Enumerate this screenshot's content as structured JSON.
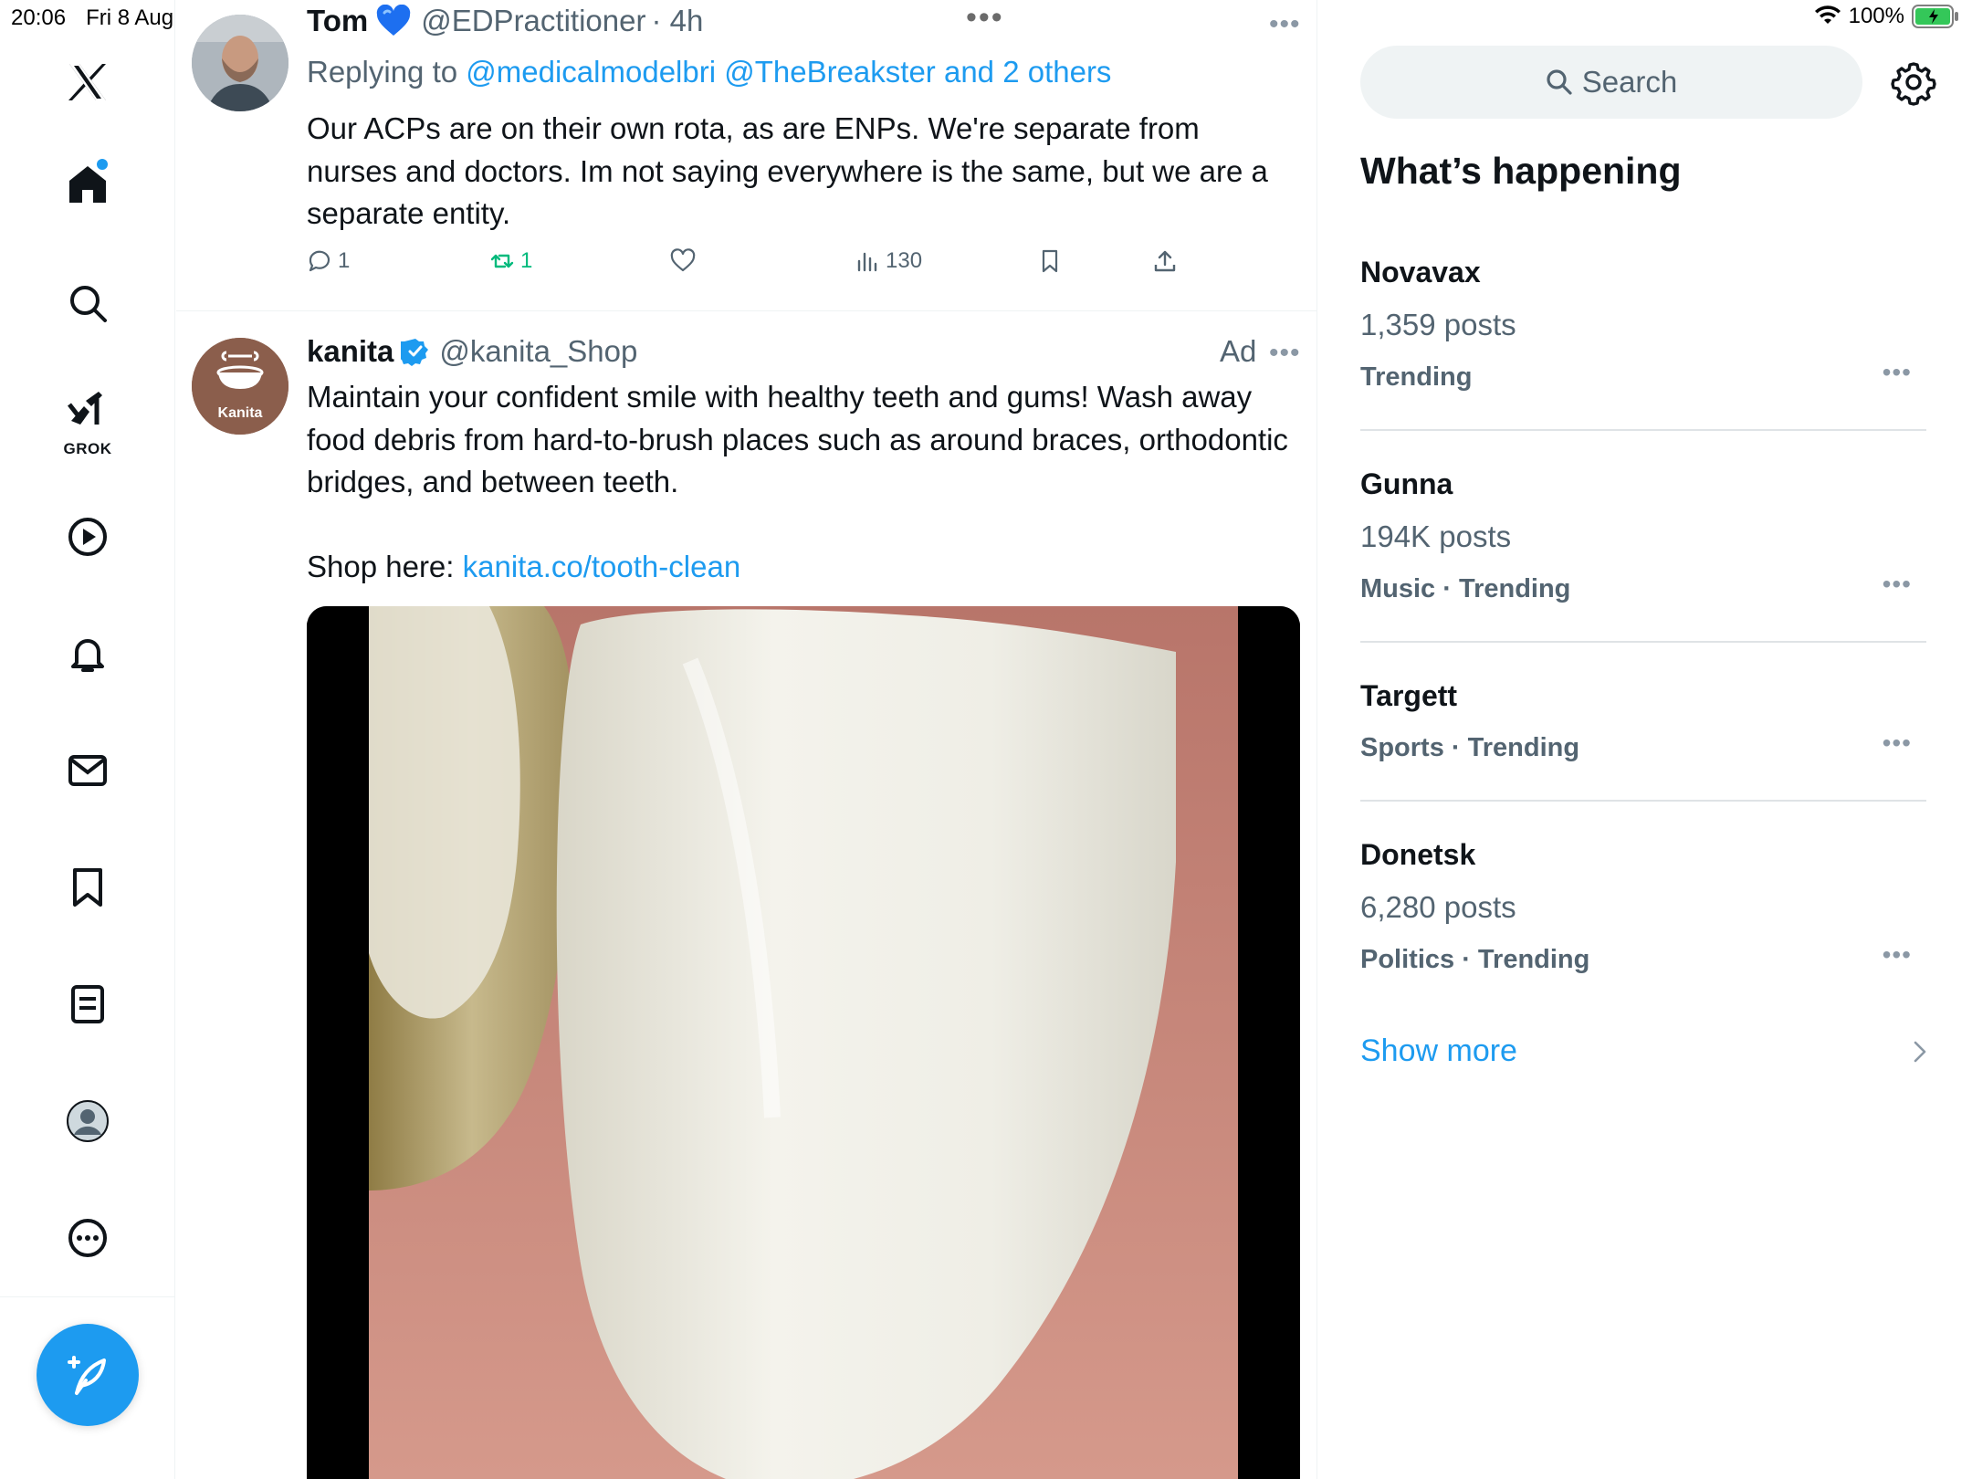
{
  "status_bar": {
    "time": "20:06",
    "date": "Fri 8 Aug",
    "battery": "100%"
  },
  "sidebar": {
    "logo": "x-logo-icon",
    "grok_label": "GROK",
    "items": [
      "home-icon",
      "search-icon",
      "grok-icon",
      "video-icon",
      "notifications-icon",
      "messages-icon",
      "bookmarks-icon",
      "lists-icon",
      "profile-icon",
      "more-icon"
    ],
    "compose": "compose-post-icon"
  },
  "timeline": {
    "reply_tweet": {
      "name": "Tom",
      "handle": "@EDPractitioner",
      "time": "· 4h",
      "replying_prefix": "Replying to",
      "replying_to": "@medicalmodelbri @TheBreakster and 2 others",
      "text": "Our ACPs are on their own rota, as are ENPs. We're separate from nurses and doctors. Im not saying everywhere is the same, but we are a separate entity.",
      "replies": "1",
      "retweets": "1",
      "views": "130"
    },
    "ad_tweet": {
      "name": "kanita",
      "handle": "@kanita_Shop",
      "ad_label": "Ad",
      "avatar_text": "Kanita",
      "text": "Maintain your confident smile with healthy teeth and gums! Wash away food debris from hard-to-brush places such as around braces, orthodontic bridges, and between teeth.",
      "shop_prefix": "Shop here:",
      "shop_link": "kanita.co/tooth-clean"
    }
  },
  "right_column": {
    "search_placeholder": "Search",
    "title": "What’s happening",
    "trends": [
      {
        "name": "Novavax",
        "posts": "1,359 posts",
        "meta": "Trending"
      },
      {
        "name": "Gunna",
        "posts": "194K posts",
        "meta": "Music · Trending"
      },
      {
        "name": "Targett",
        "posts": "",
        "meta": "Sports · Trending"
      },
      {
        "name": "Donetsk",
        "posts": "6,280 posts",
        "meta": "Politics · Trending"
      }
    ],
    "show_more": "Show more"
  },
  "colors": {
    "accent": "#1d9bf0",
    "retweet": "#00ba7c",
    "text_secondary": "#536471"
  }
}
